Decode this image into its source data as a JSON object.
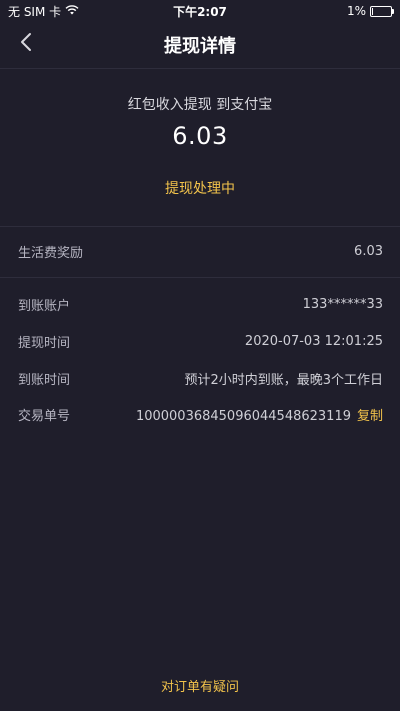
{
  "status_bar": {
    "carrier": "无 SIM 卡",
    "time": "下午2:07",
    "battery": "1%"
  },
  "nav": {
    "title": "提现详情"
  },
  "summary": {
    "subtitle": "红包收入提现 到支付宝",
    "amount": "6.03",
    "status": "提现处理中"
  },
  "details": {
    "reward": {
      "label": "生活费奖励",
      "value": "6.03"
    },
    "account": {
      "label": "到账账户",
      "value": "133******33"
    },
    "withdraw_time": {
      "label": "提现时间",
      "value": "2020-07-03 12:01:25"
    },
    "arrival_time": {
      "label": "到账时间",
      "value": "预计2小时内到账，最晚3个工作日"
    },
    "order_no": {
      "label": "交易单号",
      "value": "10000036845096044548623119",
      "copy_label": "复制"
    }
  },
  "footer": {
    "question_link": "对订单有疑问"
  },
  "colors": {
    "background": "#1f1e2b",
    "accent": "#f2c34b"
  }
}
